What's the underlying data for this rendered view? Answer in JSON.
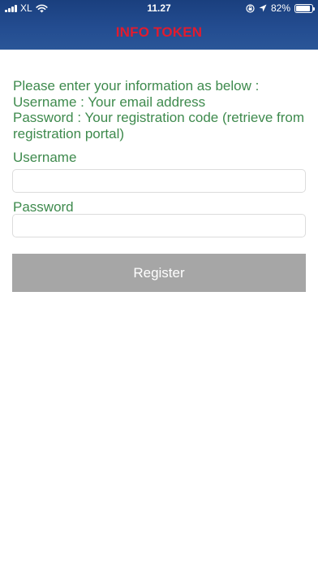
{
  "status_bar": {
    "carrier": "XL",
    "time": "11.27",
    "battery_percent": "82%",
    "battery_level": 0.82,
    "icons": [
      "signal-icon",
      "wifi-icon",
      "rotation-lock-icon",
      "location-icon",
      "battery-icon"
    ]
  },
  "header": {
    "title": "INFO TOKEN",
    "title_color": "#e21b2e",
    "background_color": "#234c90"
  },
  "instructions": {
    "lines": [
      "Please enter your information as below :",
      "Username : Your email address",
      "Password : Your registration code (retrieve from",
      "registration portal)"
    ],
    "color": "#3e8a4d"
  },
  "form": {
    "username_label": "Username",
    "username_value": "",
    "password_label": "Password",
    "password_value": "",
    "register_label": "Register",
    "button_color": "#a6a6a6"
  }
}
